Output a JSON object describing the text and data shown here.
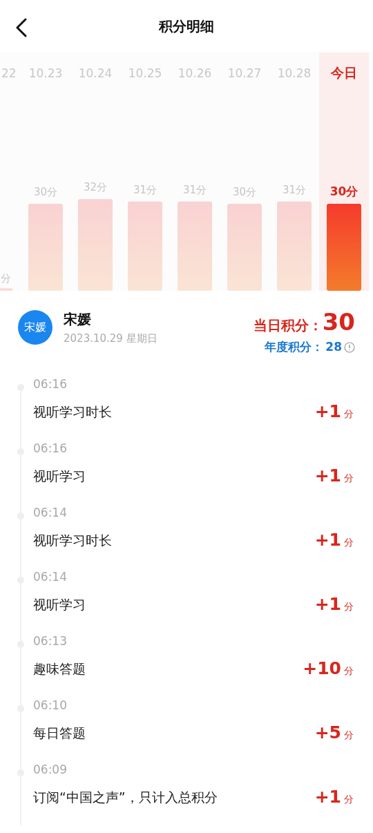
{
  "header": {
    "title": "积分明细"
  },
  "days": [
    {
      "date": "22",
      "points": "分",
      "level": 0.01,
      "selected": false
    },
    {
      "date": "10.23",
      "points": "30分",
      "level": 0.365,
      "selected": false
    },
    {
      "date": "10.24",
      "points": "32分",
      "level": 0.385,
      "selected": false
    },
    {
      "date": "10.25",
      "points": "31分",
      "level": 0.375,
      "selected": false
    },
    {
      "date": "10.26",
      "points": "31分",
      "level": 0.375,
      "selected": false
    },
    {
      "date": "10.27",
      "points": "30分",
      "level": 0.365,
      "selected": false
    },
    {
      "date": "10.28",
      "points": "31分",
      "level": 0.375,
      "selected": false
    },
    {
      "date": "今日",
      "points": "30分",
      "level": 0.365,
      "selected": true
    }
  ],
  "user": {
    "avatar_text": "宋媛",
    "name": "宋媛",
    "date": "2023.10.29 星期日"
  },
  "summary": {
    "daily_label": "当日积分：",
    "daily_value": "30",
    "yearly_label": "年度积分：",
    "yearly_value": "28"
  },
  "records": [
    {
      "time": "06:16",
      "title": "视听学习时长",
      "points": "+1",
      "unit": "分"
    },
    {
      "time": "06:16",
      "title": "视听学习",
      "points": "+1",
      "unit": "分"
    },
    {
      "time": "06:14",
      "title": "视听学习时长",
      "points": "+1",
      "unit": "分"
    },
    {
      "time": "06:14",
      "title": "视听学习",
      "points": "+1",
      "unit": "分"
    },
    {
      "time": "06:13",
      "title": "趣味答题",
      "points": "+10",
      "unit": "分"
    },
    {
      "time": "06:10",
      "title": "每日答题",
      "points": "+5",
      "unit": "分"
    },
    {
      "time": "06:09",
      "title": "订阅“中国之声”，只计入总积分",
      "points": "+1",
      "unit": "分"
    }
  ]
}
